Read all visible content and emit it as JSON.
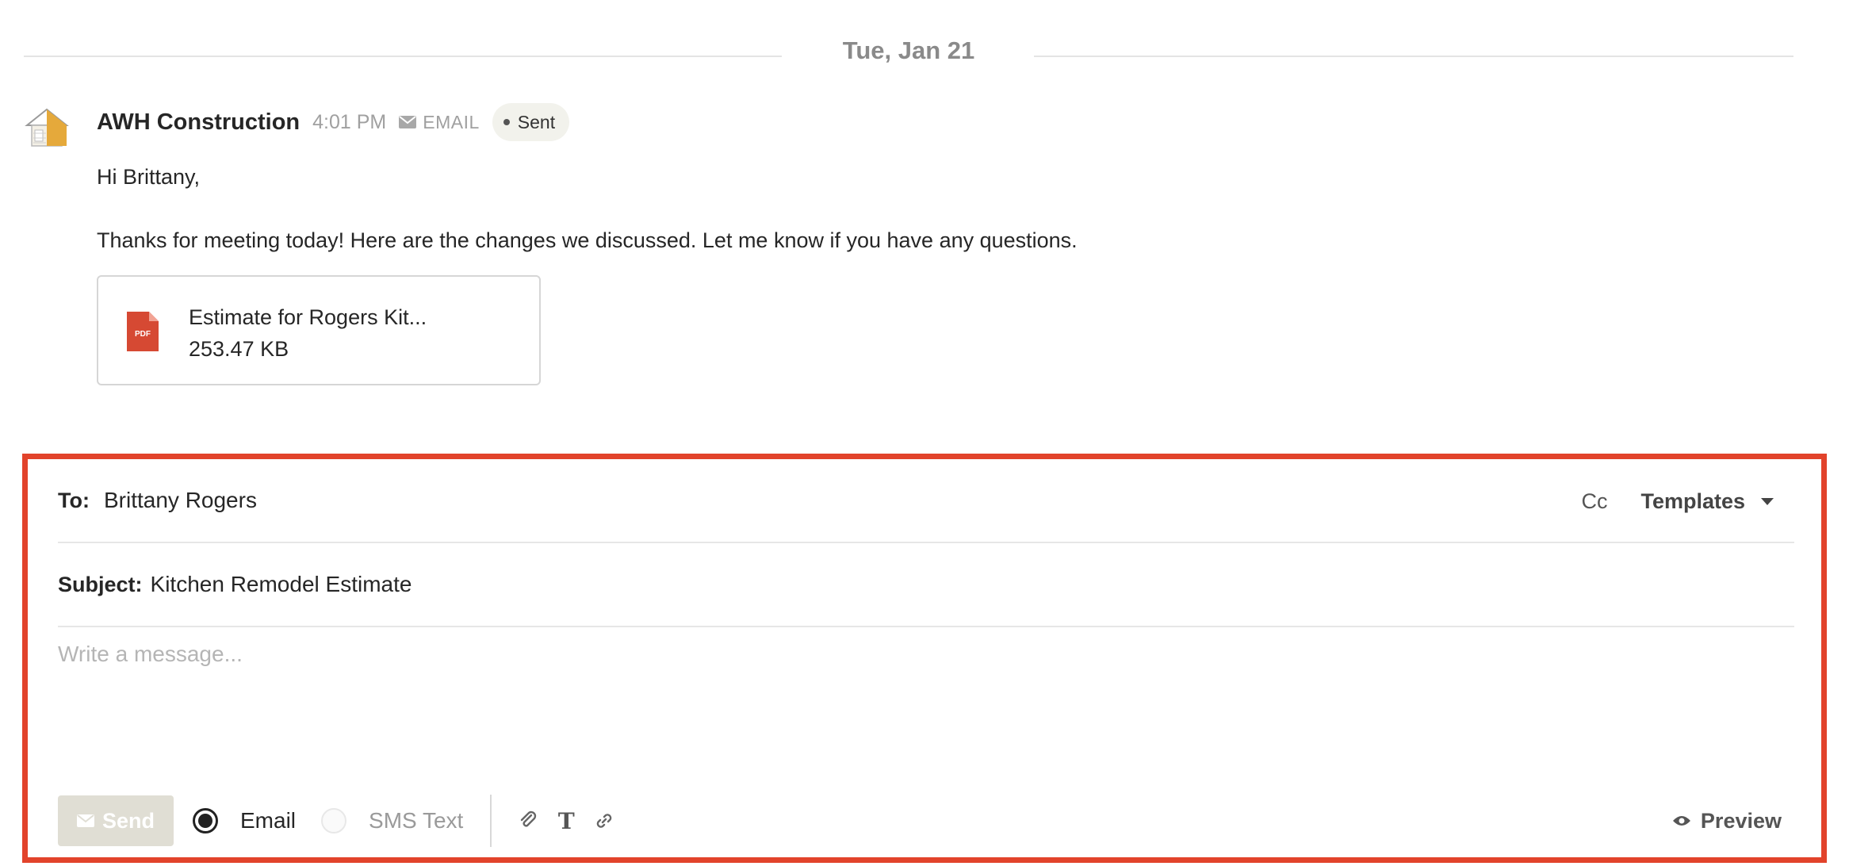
{
  "date_divider": {
    "label": "Tue, Jan 21"
  },
  "message": {
    "sender": "AWH Construction",
    "time": "4:01 PM",
    "channel": "EMAIL",
    "status": "Sent",
    "greeting": "Hi Brittany,",
    "body": "Thanks for meeting today! Here are the changes we discussed. Let me know if you have any questions.",
    "attachment": {
      "name": "Estimate for Rogers Kit...",
      "size": "253.47 KB",
      "icon": "pdf-file-icon",
      "icon_label": "PDF"
    }
  },
  "composer": {
    "to_label": "To:",
    "to_value": "Brittany Rogers",
    "cc_label": "Cc",
    "templates_label": "Templates",
    "subject_label": "Subject:",
    "subject_value": "Kitchen Remodel Estimate",
    "message_placeholder": "Write a message...",
    "send_label": "Send",
    "channels": [
      {
        "label": "Email",
        "selected": true
      },
      {
        "label": "SMS Text",
        "selected": false
      }
    ],
    "tools": [
      "attachment-icon",
      "text-format-icon",
      "link-icon"
    ],
    "preview_label": "Preview",
    "accent_color": "#e2432b"
  }
}
